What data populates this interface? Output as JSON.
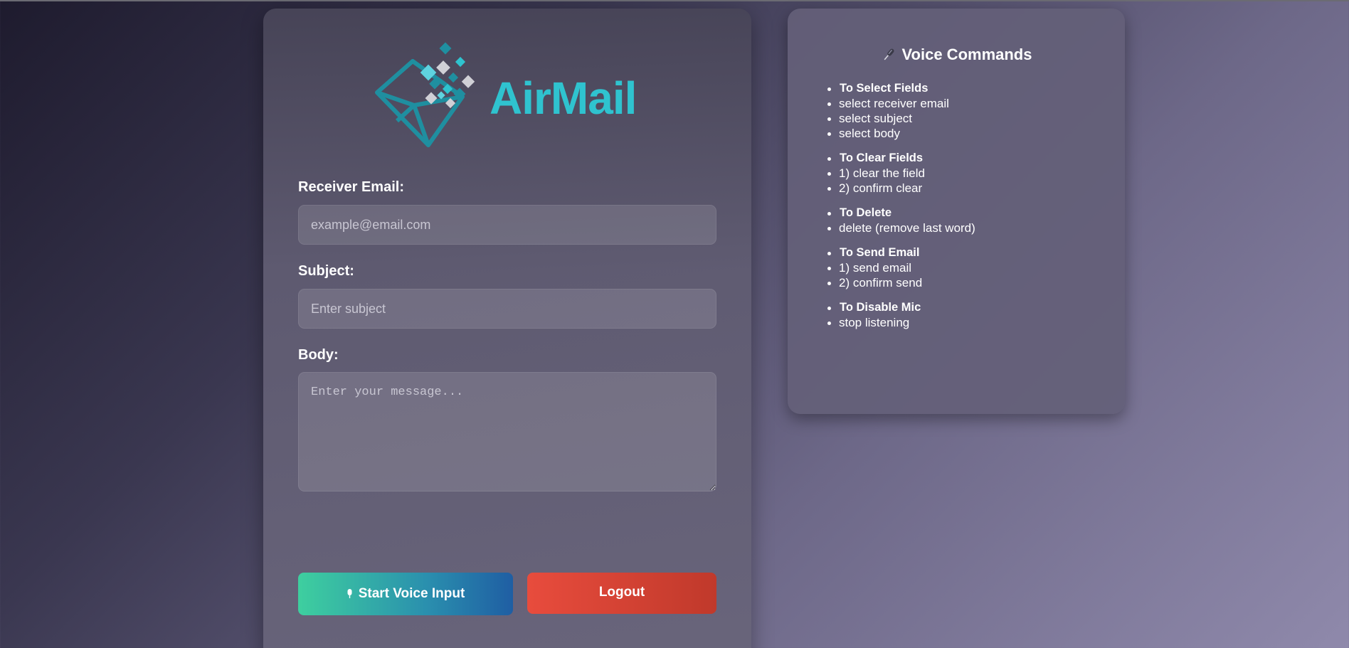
{
  "app": {
    "brand": "AirMail",
    "colors": {
      "brand": "#2fc3cf",
      "voice_button_start": "#3ecf9f",
      "voice_button_end": "#1f5ea3",
      "logout_button": "#e84c3d"
    }
  },
  "form": {
    "receiver": {
      "label": "Receiver Email:",
      "placeholder": "example@email.com",
      "value": ""
    },
    "subject": {
      "label": "Subject:",
      "placeholder": "Enter subject",
      "value": ""
    },
    "body": {
      "label": "Body:",
      "placeholder": "Enter your message...",
      "value": ""
    },
    "voice_button": {
      "label": "Start Voice Input",
      "icon": "microphone-icon"
    },
    "logout_button": {
      "label": "Logout"
    }
  },
  "commands": {
    "title": "Voice Commands",
    "title_icon": "microphone-icon",
    "groups": [
      {
        "heading": "To Select Fields",
        "items": [
          "select receiver email",
          "select subject",
          "select body"
        ]
      },
      {
        "heading": "To Clear Fields",
        "items": [
          "1) clear the field",
          "2) confirm clear"
        ]
      },
      {
        "heading": "To Delete",
        "items": [
          "delete (remove last word)"
        ]
      },
      {
        "heading": "To Send Email",
        "items": [
          "1) send email",
          "2) confirm send"
        ]
      },
      {
        "heading": "To Disable Mic",
        "items": [
          "stop listening"
        ]
      }
    ]
  }
}
